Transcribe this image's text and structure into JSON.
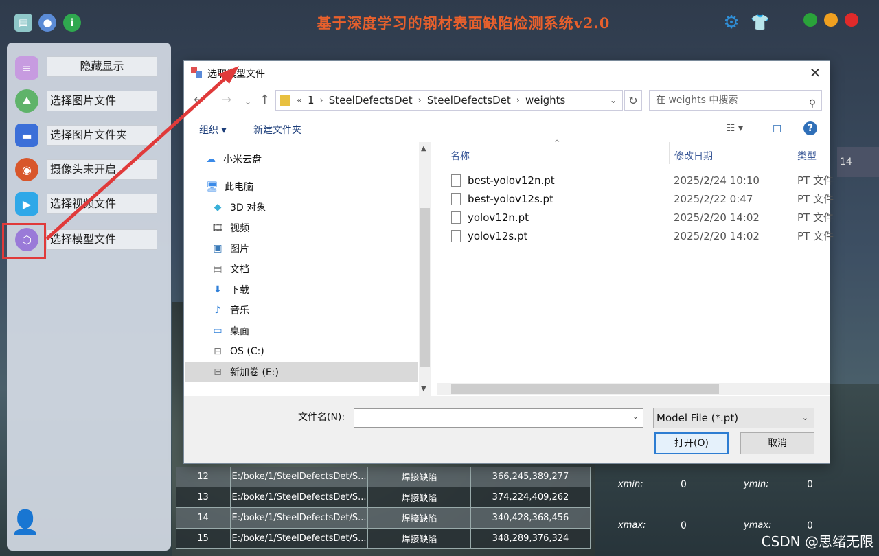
{
  "app": {
    "title": "基于深度学习的钢材表面缺陷检测系统v2.0"
  },
  "sidebar": {
    "items": [
      {
        "label": "隐藏显示"
      },
      {
        "label": "选择图片文件"
      },
      {
        "label": "选择图片文件夹"
      },
      {
        "label": "摄像头未开启"
      },
      {
        "label": "选择视频文件"
      },
      {
        "label": "选择模型文件"
      }
    ]
  },
  "background_table": {
    "rows": [
      {
        "id": "12",
        "path": "E:/boke/1/SteelDefectsDet/S...",
        "type": "焊接缺陷",
        "box": "366,245,389,277"
      },
      {
        "id": "13",
        "path": "E:/boke/1/SteelDefectsDet/S...",
        "type": "焊接缺陷",
        "box": "374,224,409,262"
      },
      {
        "id": "14",
        "path": "E:/boke/1/SteelDefectsDet/S...",
        "type": "焊接缺陷",
        "box": "340,428,368,456"
      },
      {
        "id": "15",
        "path": "E:/boke/1/SteelDefectsDet/S...",
        "type": "焊接缺陷",
        "box": "348,289,376,324"
      }
    ],
    "side_number": "14"
  },
  "info": {
    "xmin_label": "xmin:",
    "xmin": "0",
    "ymin_label": "ymin:",
    "ymin": "0",
    "xmax_label": "xmax:",
    "xmax": "0",
    "ymax_label": "ymax:",
    "ymax": "0"
  },
  "dialog": {
    "title": "选取模型文件",
    "breadcrumb": [
      "1",
      "SteelDefectsDet",
      "SteelDefectsDet",
      "weights"
    ],
    "search_placeholder": "在 weights 中搜索",
    "toolbar": {
      "organize": "组织 ▾",
      "new_folder": "新建文件夹"
    },
    "nav": [
      {
        "label": "小米云盘",
        "icon": "cloud-icon"
      },
      {
        "label": "此电脑",
        "icon": "computer-icon"
      },
      {
        "label": "3D 对象",
        "icon": "cube-icon"
      },
      {
        "label": "视频",
        "icon": "video-icon"
      },
      {
        "label": "图片",
        "icon": "picture-icon"
      },
      {
        "label": "文档",
        "icon": "document-icon"
      },
      {
        "label": "下载",
        "icon": "download-icon"
      },
      {
        "label": "音乐",
        "icon": "music-icon"
      },
      {
        "label": "桌面",
        "icon": "desktop-icon"
      },
      {
        "label": "OS (C:)",
        "icon": "drive-icon"
      },
      {
        "label": "新加卷 (E:)",
        "icon": "drive-icon"
      }
    ],
    "columns": {
      "name": "名称",
      "date": "修改日期",
      "type": "类型"
    },
    "files": [
      {
        "name": "best-yolov12n.pt",
        "date": "2025/2/24 10:10",
        "type": "PT 文件"
      },
      {
        "name": "best-yolov12s.pt",
        "date": "2025/2/22 0:47",
        "type": "PT 文件"
      },
      {
        "name": "yolov12n.pt",
        "date": "2025/2/20 14:02",
        "type": "PT 文件"
      },
      {
        "name": "yolov12s.pt",
        "date": "2025/2/20 14:02",
        "type": "PT 文件"
      }
    ],
    "filename_label": "文件名(N):",
    "filename_value": "",
    "filter": "Model File (*.pt)",
    "open_button": "打开(O)",
    "cancel_button": "取消"
  },
  "watermark": "CSDN @思绪无限",
  "colors": {
    "title": "#e8602c",
    "highlight": "#e03a3a",
    "accent": "#2d7dd2"
  }
}
